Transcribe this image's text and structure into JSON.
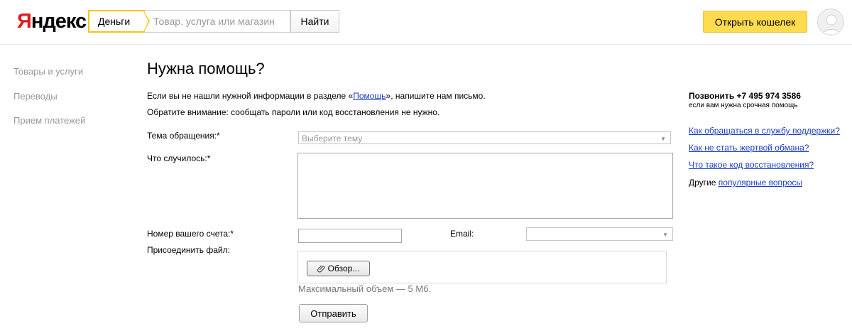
{
  "header": {
    "logo_first": "Я",
    "logo_rest": "ндекс",
    "service_tab": "Деньги",
    "search_placeholder": "Товар, услуга или магазин",
    "search_button": "Найти",
    "wallet_button": "Открыть кошелек"
  },
  "sidebar": {
    "items": [
      {
        "label": "Товары и услуги"
      },
      {
        "label": "Переводы"
      },
      {
        "label": "Прием платежей"
      }
    ]
  },
  "main": {
    "title": "Нужна помощь?",
    "intro_before": "Если вы не нашли нужной информации в разделе «",
    "intro_link": "Помощь",
    "intro_after": "», напишите нам письмо.",
    "intro2": "Обратите внимание: сообщать пароли или код восстановления не нужно.",
    "form": {
      "topic_label": "Тема обращения:*",
      "topic_placeholder": "Выберите тему",
      "what_label": "Что случилось:*",
      "account_label": "Номер вашего счета:*",
      "email_label": "Email:",
      "attach_label": "Присоединить файл:",
      "browse_button": "Обзор...",
      "file_hint": "Максимальный объем — 5 Мб.",
      "submit_button": "Отправить"
    }
  },
  "right": {
    "call_title": "Позвонить +7 495 974 3586",
    "call_sub": "если вам нужна срочная помощь",
    "links": [
      "Как обращаться в службу поддержки?",
      "Как не стать жертвой обмана?",
      "Что такое код восстановления?"
    ],
    "other_prefix": "Другие ",
    "other_link": "популярные вопросы"
  },
  "colors": {
    "accent_yellow": "#ffdb4d",
    "link_blue": "#1a3dc1",
    "logo_red": "#e41a1a"
  }
}
